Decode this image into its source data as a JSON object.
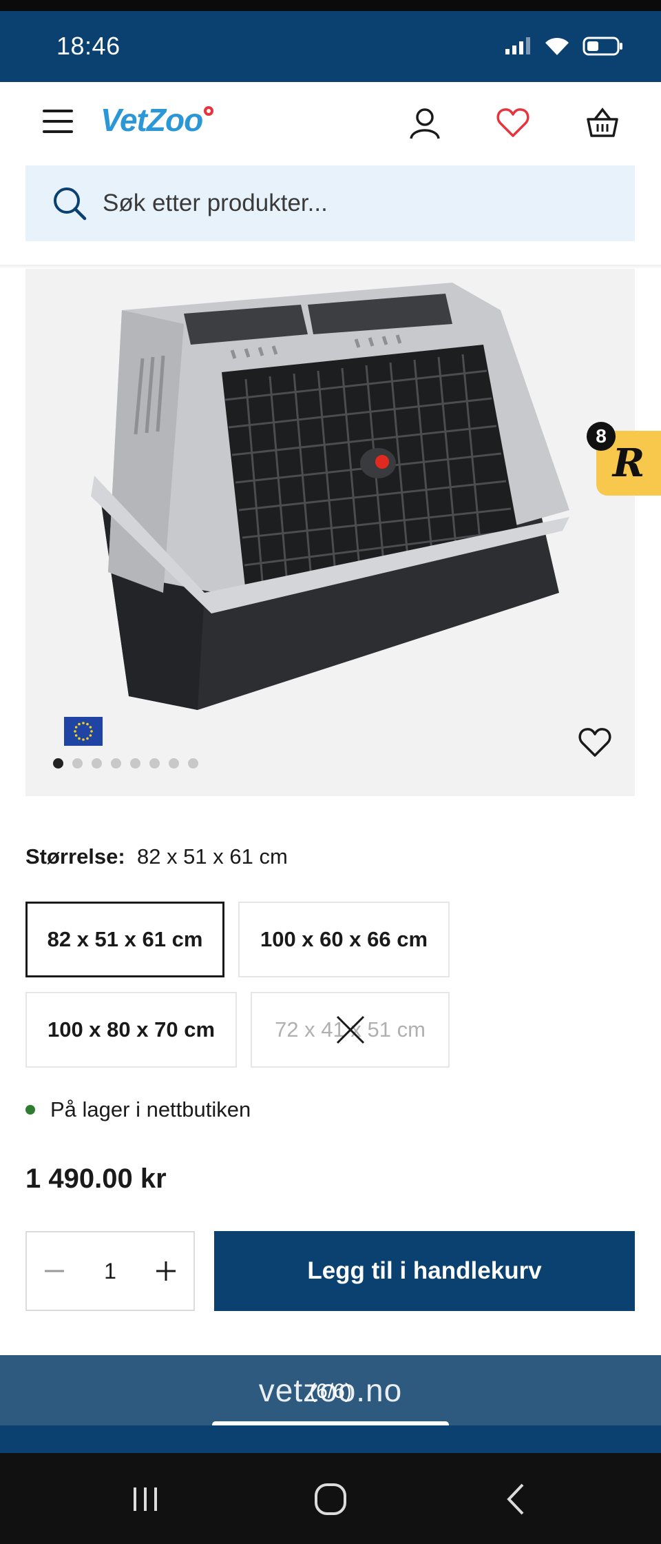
{
  "status_bar": {
    "time": "18:46",
    "battery_percent": 40
  },
  "header": {
    "logo_text": "VetZoo",
    "icons": [
      "menu-icon",
      "user-icon",
      "heart-icon",
      "basket-icon"
    ]
  },
  "search": {
    "placeholder": "Søk etter produkter..."
  },
  "gallery": {
    "image_count": 8,
    "active_index": 0,
    "badge": "EU-flag"
  },
  "review_badge": {
    "count": "8",
    "letter": "R"
  },
  "size": {
    "label": "Størrelse:",
    "selected_value": "82 x 51 x 61 cm",
    "options": [
      {
        "label": "82 x 51 x 61 cm",
        "selected": true,
        "available": true
      },
      {
        "label": "100 x 60 x 66 cm",
        "selected": false,
        "available": true
      },
      {
        "label": "100 x 80 x 70 cm",
        "selected": false,
        "available": true
      },
      {
        "label": "72 x 41 x 51 cm",
        "selected": false,
        "available": false
      }
    ]
  },
  "stock": {
    "text": "På lager i nettbutiken"
  },
  "price": "1 490.00 kr",
  "quantity": {
    "value": "1"
  },
  "add_to_cart": "Legg til i handlekurv",
  "browser": {
    "url": "vetzoo.no",
    "page_indicator": "(6/6)"
  },
  "colors": {
    "brand_blue": "#0a4170",
    "logo_blue": "#2b97d6",
    "heart_red": "#e8323c",
    "stock_green": "#2e7d32",
    "badge_yellow": "#f7c84b"
  }
}
